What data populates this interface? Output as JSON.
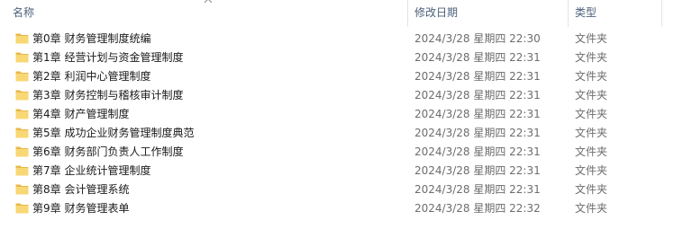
{
  "columns": {
    "name": "名称",
    "date": "修改日期",
    "type": "类型"
  },
  "icons": {
    "sort": "chevron-up-icon",
    "item": "folder-icon"
  },
  "colors": {
    "folder_fill": "#f8d775",
    "folder_tab": "#e8b84a",
    "header_text": "#4c607a"
  },
  "files": [
    {
      "name": "第0章  财务管理制度统编",
      "date": "2024/3/28 星期四 22:30",
      "type": "文件夹"
    },
    {
      "name": "第1章  经营计划与资金管理制度",
      "date": "2024/3/28 星期四 22:31",
      "type": "文件夹"
    },
    {
      "name": "第2章  利润中心管理制度",
      "date": "2024/3/28 星期四 22:31",
      "type": "文件夹"
    },
    {
      "name": "第3章  财务控制与稽核审计制度",
      "date": "2024/3/28 星期四 22:31",
      "type": "文件夹"
    },
    {
      "name": "第4章  财产管理制度",
      "date": "2024/3/28 星期四 22:31",
      "type": "文件夹"
    },
    {
      "name": "第5章  成功企业财务管理制度典范",
      "date": "2024/3/28 星期四 22:31",
      "type": "文件夹"
    },
    {
      "name": "第6章  财务部门负责人工作制度",
      "date": "2024/3/28 星期四 22:31",
      "type": "文件夹"
    },
    {
      "name": "第7章  企业统计管理制度",
      "date": "2024/3/28 星期四 22:31",
      "type": "文件夹"
    },
    {
      "name": "第8章  会计管理系统",
      "date": "2024/3/28 星期四 22:31",
      "type": "文件夹"
    },
    {
      "name": "第9章  财务管理表单",
      "date": "2024/3/28 星期四 22:32",
      "type": "文件夹"
    }
  ]
}
